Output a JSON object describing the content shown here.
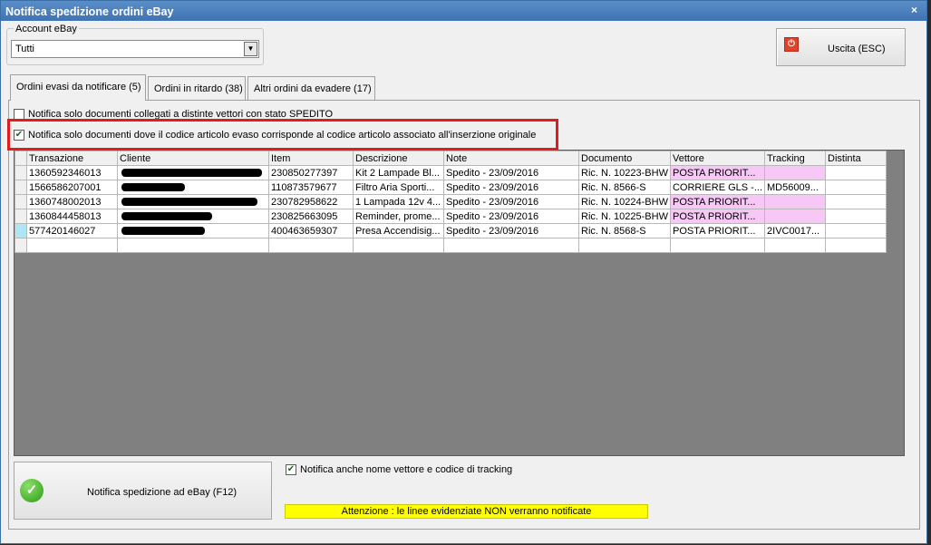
{
  "window": {
    "title": "Notifica spedizione ordini eBay",
    "close": "×"
  },
  "account": {
    "legend": "Account eBay",
    "selected": "Tutti"
  },
  "exit_button": {
    "label": "Uscita (ESC)"
  },
  "tabs": [
    {
      "label": "Ordini evasi da notificare (5)"
    },
    {
      "label": "Ordini in ritardo (38)"
    },
    {
      "label": "Altri ordini da evadere (17)"
    }
  ],
  "filters": {
    "only_shipped_carrier": {
      "label": "Notifica solo documenti  collegati a distinte vettori con stato SPEDITO",
      "checked": false
    },
    "matching_item_code": {
      "label": "Notifica solo documenti dove il codice articolo evaso corrisponde al codice articolo associato all'inserzione originale",
      "checked": true
    }
  },
  "grid": {
    "columns": [
      "Transazione",
      "Cliente",
      "Item",
      "Descrizione",
      "Note",
      "Documento",
      "Vettore",
      "Tracking",
      "Distinta"
    ],
    "rows": [
      {
        "transazione": "1360592346013",
        "cliente": "",
        "item": "230850277397",
        "descrizione": "Kit 2 Lampade Bl...",
        "note": "Spedito - 23/09/2016",
        "documento": "Ric. N. 10223-BHW",
        "vettore": "POSTA PRIORIT...",
        "tracking": "",
        "distinta": ""
      },
      {
        "transazione": "1566586207001",
        "cliente": "",
        "item": "110873579677",
        "descrizione": "Filtro Aria Sporti...",
        "note": "Spedito - 23/09/2016",
        "documento": "Ric. N. 8566-S",
        "vettore": "CORRIERE GLS -...",
        "tracking": "MD56009...",
        "distinta": ""
      },
      {
        "transazione": "1360748002013",
        "cliente": "",
        "item": "230782958622",
        "descrizione": "1 Lampada 12v 4...",
        "note": "Spedito - 23/09/2016",
        "documento": "Ric. N. 10224-BHW",
        "vettore": "POSTA PRIORIT...",
        "tracking": "",
        "distinta": ""
      },
      {
        "transazione": "1360844458013",
        "cliente": "",
        "item": "230825663095",
        "descrizione": "Reminder, prome...",
        "note": "Spedito - 23/09/2016",
        "documento": "Ric. N. 10225-BHW",
        "vettore": "POSTA PRIORIT...",
        "tracking": "",
        "distinta": ""
      },
      {
        "transazione": "577420146027",
        "cliente": "",
        "item": "400463659307",
        "descrizione": "Presa Accendisig...",
        "note": "Spedito - 23/09/2016",
        "documento": "Ric. N. 8568-S",
        "vettore": "POSTA PRIORIT...",
        "tracking": "2IVC0017...",
        "distinta": ""
      }
    ]
  },
  "notify_button": {
    "label": "Notifica spedizione ad eBay (F12)"
  },
  "notify_tracking": {
    "label": "Notifica anche nome vettore e codice di tracking",
    "checked": true
  },
  "warning": {
    "text": "Attenzione : le linee evidenziate NON verranno notificate",
    "color": "#ffff00"
  },
  "colors": {
    "highlight": "#f7c7f5",
    "titlebar": "#4a7fbd",
    "alert_border": "#e21c1c"
  }
}
